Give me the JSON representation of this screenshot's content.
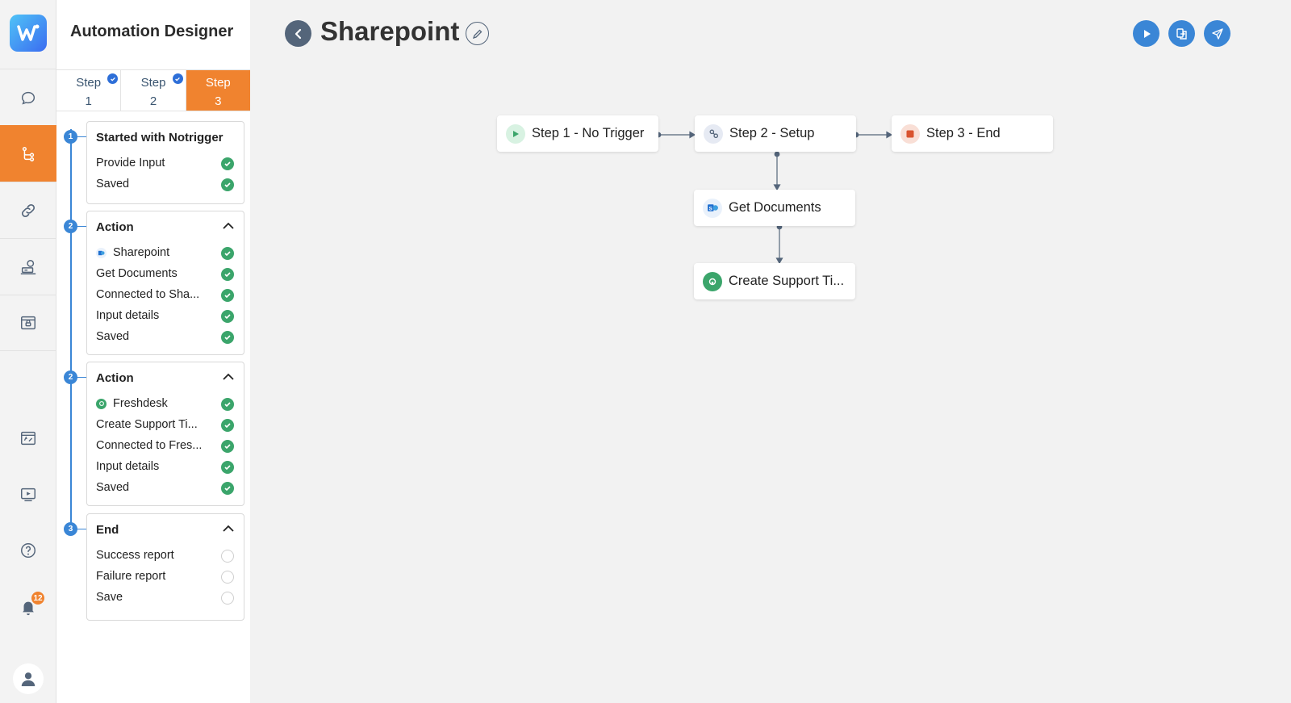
{
  "app": {
    "title": "Automation Designer"
  },
  "sidebar_nav": {
    "items": [
      {
        "name": "chat",
        "icon": "chat-bubble-icon",
        "active": false
      },
      {
        "name": "workflow",
        "icon": "flow-branch-icon",
        "active": true
      },
      {
        "name": "integrations",
        "icon": "link-icon",
        "active": false
      },
      {
        "name": "bots",
        "icon": "bot-desk-icon",
        "active": false
      },
      {
        "name": "archive",
        "icon": "archive-box-icon",
        "active": false
      },
      {
        "name": "forms",
        "icon": "form-edit-icon",
        "active": false
      },
      {
        "name": "media",
        "icon": "video-play-icon",
        "active": false
      },
      {
        "name": "help",
        "icon": "help-circle-icon",
        "active": false
      },
      {
        "name": "notifications",
        "icon": "bell-icon",
        "active": false
      }
    ],
    "notification_count": "12",
    "accent_color": "#f0832f"
  },
  "step_tabs": [
    {
      "line1": "Step",
      "line2": "1",
      "done": true
    },
    {
      "line1": "Step",
      "line2": "2",
      "done": true
    },
    {
      "line1": "Step",
      "line2": "3",
      "done": false,
      "active": true
    }
  ],
  "checklist": [
    {
      "num": "1",
      "title": "Started with Notrigger",
      "collapsible": false,
      "rows": [
        {
          "label": "Provide Input",
          "state": "done"
        },
        {
          "label": "Saved",
          "state": "done"
        }
      ]
    },
    {
      "num": "2",
      "title": "Action",
      "collapsible": true,
      "rows": [
        {
          "label": "Sharepoint",
          "state": "done",
          "app_icon": "sharepoint-icon"
        },
        {
          "label": "Get Documents",
          "state": "done"
        },
        {
          "label": "Connected to Sha...",
          "state": "done"
        },
        {
          "label": "Input details",
          "state": "done"
        },
        {
          "label": "Saved",
          "state": "done"
        }
      ]
    },
    {
      "num": "2",
      "title": "Action",
      "collapsible": true,
      "rows": [
        {
          "label": "Freshdesk",
          "state": "done",
          "app_icon": "freshdesk-icon"
        },
        {
          "label": "Create Support Ti...",
          "state": "done"
        },
        {
          "label": "Connected to Fres...",
          "state": "done"
        },
        {
          "label": "Input details",
          "state": "done"
        },
        {
          "label": "Saved",
          "state": "done"
        }
      ]
    },
    {
      "num": "3",
      "title": "End",
      "collapsible": true,
      "rows": [
        {
          "label": "Success report",
          "state": "pending"
        },
        {
          "label": "Failure report",
          "state": "pending"
        },
        {
          "label": "Save",
          "state": "pending"
        }
      ]
    }
  ],
  "header": {
    "title": "Sharepoint",
    "back_icon": "chevron-left-icon",
    "edit_icon": "pencil-icon",
    "actions": [
      {
        "name": "run",
        "icon": "play-icon"
      },
      {
        "name": "duplicate",
        "icon": "copy-icon"
      },
      {
        "name": "publish",
        "icon": "send-icon"
      }
    ]
  },
  "flow": {
    "nodes": {
      "step1": {
        "label": "Step 1 - No Trigger",
        "icon": "play-icon"
      },
      "step2": {
        "label": "Step 2 - Setup",
        "icon": "setup-icon"
      },
      "step3": {
        "label": "Step 3 - End",
        "icon": "stop-icon"
      },
      "get_docs": {
        "label": "Get Documents",
        "icon": "sharepoint-icon"
      },
      "create_ticket": {
        "label": "Create Support Ti...",
        "icon": "freshdesk-icon"
      }
    }
  },
  "colors": {
    "primary": "#3a86d6",
    "accent": "#f0832f",
    "success": "#3ba56b",
    "header_dark": "#54657a"
  }
}
